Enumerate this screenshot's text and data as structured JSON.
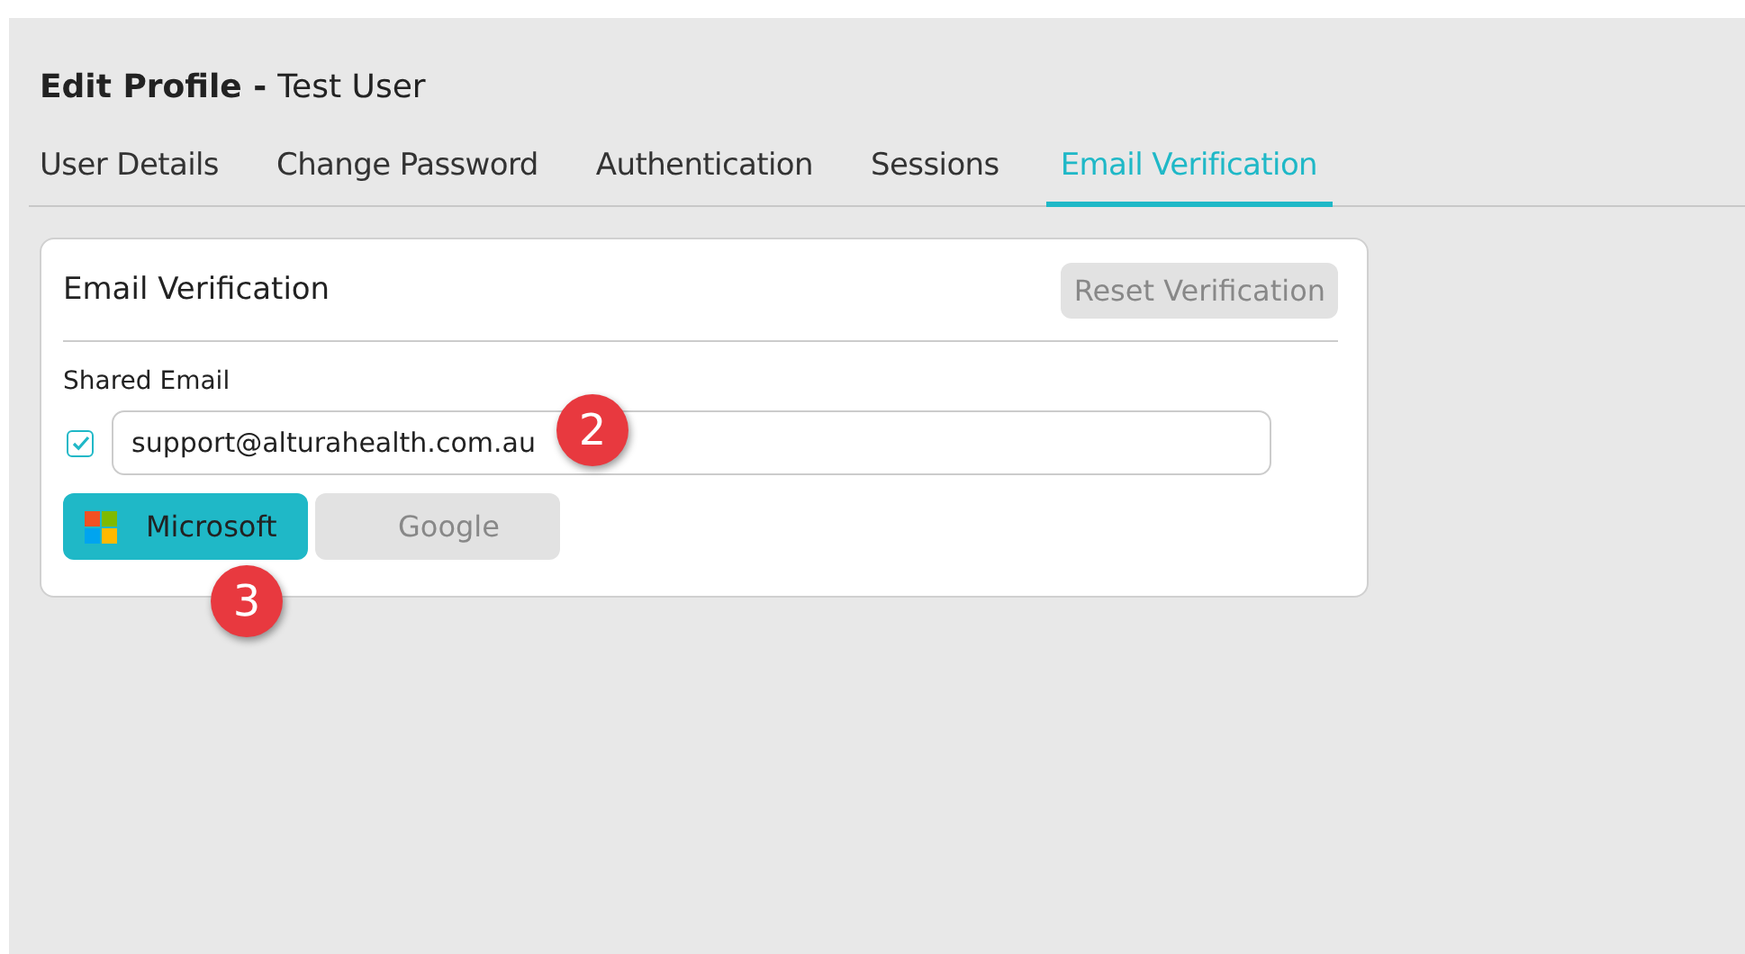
{
  "header": {
    "title": "Edit Profile -",
    "subtitle": "Test User"
  },
  "tabs": [
    {
      "label": "User Details",
      "selected": false
    },
    {
      "label": "Change Password",
      "selected": false
    },
    {
      "label": "Authentication",
      "selected": false
    },
    {
      "label": "Sessions",
      "selected": false
    },
    {
      "label": "Email Verification",
      "selected": true
    }
  ],
  "card": {
    "title": "Email Verification",
    "reset_button": {
      "label": "Reset Verification",
      "disabled": true
    },
    "field_label": "Shared Email",
    "shared": {
      "checked": true
    },
    "email": {
      "value": "support@alturahealth.com.au"
    },
    "providers": [
      {
        "label": "Microsoft",
        "kind": "microsoft",
        "selected": true
      },
      {
        "label": "Google",
        "kind": "google",
        "selected": false
      }
    ]
  },
  "callouts": [
    {
      "label": "2"
    },
    {
      "label": "3"
    }
  ]
}
